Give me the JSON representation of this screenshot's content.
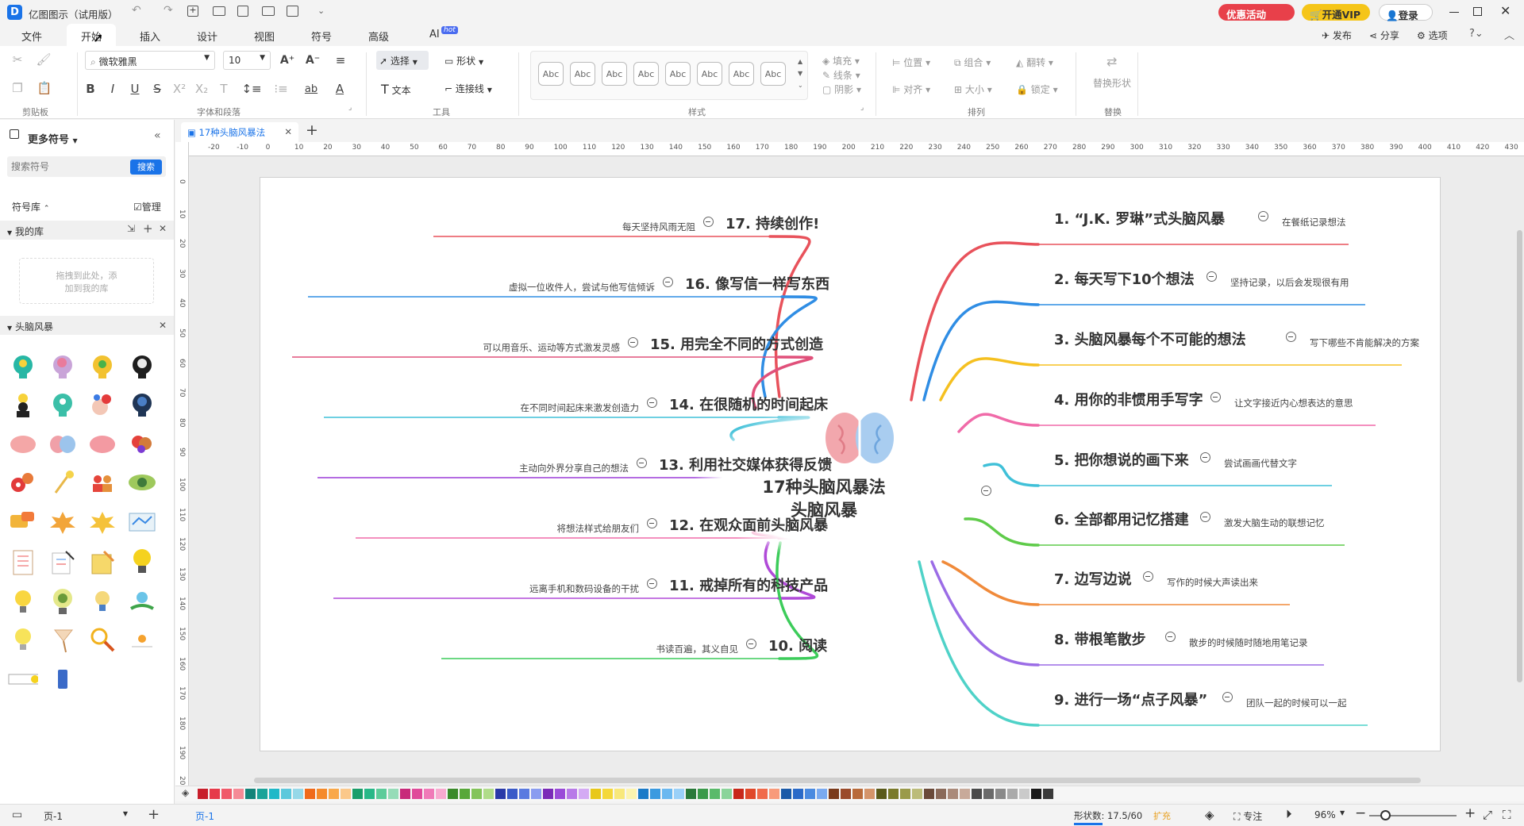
{
  "app": {
    "title": "亿图图示（试用版）",
    "promo_label": "优惠活动",
    "vip_label": "开通VIP",
    "login_label": "登录"
  },
  "menu": {
    "items": [
      "文件",
      "开始",
      "插入",
      "设计",
      "视图",
      "符号",
      "高级",
      "AI"
    ],
    "active": "开始",
    "ai_badge": "hot",
    "right_items": [
      "发布",
      "分享",
      "选项"
    ]
  },
  "ribbon": {
    "font_name": "微软雅黑",
    "font_size": "10",
    "select_label": "选择",
    "shape_label": "形状",
    "text_label": "文本",
    "connector_label": "连接线",
    "style_sample": "Abc",
    "fill_label": "填充",
    "line_label": "线条",
    "shadow_label": "阴影",
    "position_label": "位置",
    "group_label": "组合",
    "flip_label": "翻转",
    "align_label": "对齐",
    "size_label": "大小",
    "lock_label": "锁定",
    "replace_shape_label": "替换形状",
    "group_labels": {
      "clipboard": "剪贴板",
      "font_paragraph": "字体和段落",
      "tools": "工具",
      "styles": "样式",
      "arrange": "排列",
      "replace": "替换"
    }
  },
  "left_panel": {
    "header": "更多符号",
    "search_placeholder": "搜索符号",
    "search_button": "搜索",
    "library_label": "符号库",
    "manage_label": "管理",
    "my_library": "我的库",
    "drop_hint_1": "拖拽到此处，添",
    "drop_hint_2": "加到我的库",
    "section_name": "头脑风暴"
  },
  "document": {
    "tab_name": "17种头脑风暴法"
  },
  "ruler": {
    "h_ticks": [
      "-20",
      "-10",
      "0",
      "10",
      "20",
      "30",
      "40",
      "50",
      "60",
      "70",
      "80",
      "90",
      "100",
      "110",
      "120",
      "130",
      "140",
      "150",
      "160",
      "170",
      "180",
      "190",
      "200",
      "210",
      "220",
      "230",
      "240",
      "250",
      "260",
      "270",
      "280",
      "290",
      "300",
      "310",
      "320",
      "330",
      "340",
      "350",
      "360",
      "370",
      "380",
      "390",
      "400",
      "410",
      "420",
      "430"
    ],
    "v_ticks": [
      "0",
      "10",
      "20",
      "30",
      "40",
      "50",
      "60",
      "70",
      "80",
      "90",
      "100",
      "110",
      "120",
      "130",
      "140",
      "150",
      "160",
      "170",
      "180",
      "190",
      "200"
    ]
  },
  "mindmap": {
    "center_line1": "17种头脑风暴法",
    "center_line2": "头脑风暴",
    "right": [
      {
        "topic": "1. “J.K. 罗琳”式头脑风暴",
        "note": "在餐纸记录想法",
        "color": "#e8525b"
      },
      {
        "topic": "2. 每天写下10个想法",
        "note": "坚持记录，以后会发现很有用",
        "color": "#2f8de4"
      },
      {
        "topic": "3. 头脑风暴每个不可能的想法",
        "note": "写下哪些不肯能解决的方案",
        "color": "#f5c020"
      },
      {
        "topic": "4. 用你的非惯用手写字",
        "note": "让文字接近内心想表达的意思",
        "color": "#f06aa8"
      },
      {
        "topic": "5. 把你想说的画下来",
        "note": "尝试画画代替文字",
        "color": "#3fc0d8"
      },
      {
        "topic": "6. 全部都用记忆搭建",
        "note": "激发大脑生动的联想记忆",
        "color": "#5fcb4a"
      },
      {
        "topic": "7. 边写边说",
        "note": "写作的时候大声读出来",
        "color": "#f08a3a"
      },
      {
        "topic": "8. 带根笔散步",
        "note": "散步的时候随时随地用笔记录",
        "color": "#9b6ce6"
      },
      {
        "topic": "9. 进行一场“点子风暴”",
        "note": "团队一起的时候可以一起",
        "color": "#4fd2c8"
      }
    ],
    "left": [
      {
        "topic": "17. 持续创作!",
        "note": "每天坚持风雨无阻",
        "color": "#e8525b"
      },
      {
        "topic": "16. 像写信一样写东西",
        "note": "虚拟一位收件人，尝试与他写信倾诉",
        "color": "#2f8de4"
      },
      {
        "topic": "15. 用完全不同的方式创造",
        "note": "可以用音乐、运动等方式激发灵感",
        "color": "#e0507a"
      },
      {
        "topic": "14. 在很随机的时间起床",
        "note": "在不同时间起床来激发创造力",
        "color": "#3fc0d8"
      },
      {
        "topic": "13. 利用社交媒体获得反馈",
        "note": "主动向外界分享自己的想法",
        "color": "#9b3cd8"
      },
      {
        "topic": "12. 在观众面前头脑风暴",
        "note": "将想法样式给朋友们",
        "color": "#f06aa8"
      },
      {
        "topic": "11. 戒掉所有的科技产品",
        "note": "远离手机和数码设备的干扰",
        "color": "#b04ad8"
      },
      {
        "topic": "10. 阅读",
        "note": "书读百遍，其义自见",
        "color": "#3ccc5a"
      }
    ]
  },
  "status": {
    "page_selector": "页-1",
    "page_tab": "页-1",
    "shape_count": "形状数: 17.5/60",
    "expand_label": "扩充",
    "focus_label": "专注",
    "zoom": "96%"
  },
  "colors": {
    "accent": "#1a73e8",
    "promo": "#e8404a",
    "vip": "#f5c518"
  }
}
